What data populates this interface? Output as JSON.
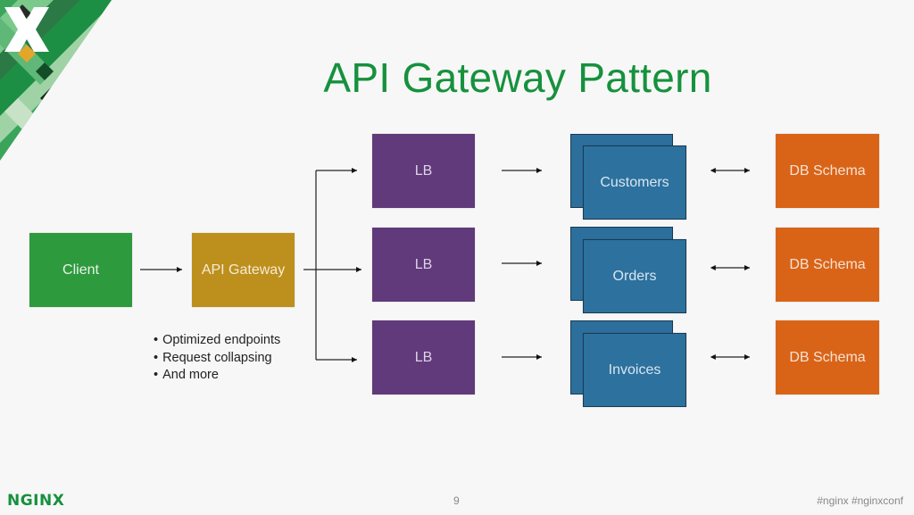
{
  "slide": {
    "title": "API Gateway Pattern",
    "page_number": "9",
    "footer_logo": "NGINX",
    "hashtags": "#nginx #nginxconf"
  },
  "diagram": {
    "client": "Client",
    "gateway": "API Gateway",
    "gateway_notes": [
      "Optimized endpoints",
      "Request collapsing",
      "And more"
    ],
    "rows": [
      {
        "lb": "LB",
        "service": "Customers",
        "db": "DB Schema"
      },
      {
        "lb": "LB",
        "service": "Orders",
        "db": "DB Schema"
      },
      {
        "lb": "LB",
        "service": "Invoices",
        "db": "DB Schema"
      }
    ],
    "colors": {
      "client": "#2e9a3e",
      "gateway": "#bd8f1c",
      "lb": "#603a7a",
      "service": "#2d719e",
      "db": "#d96418",
      "title": "#16913d"
    }
  }
}
